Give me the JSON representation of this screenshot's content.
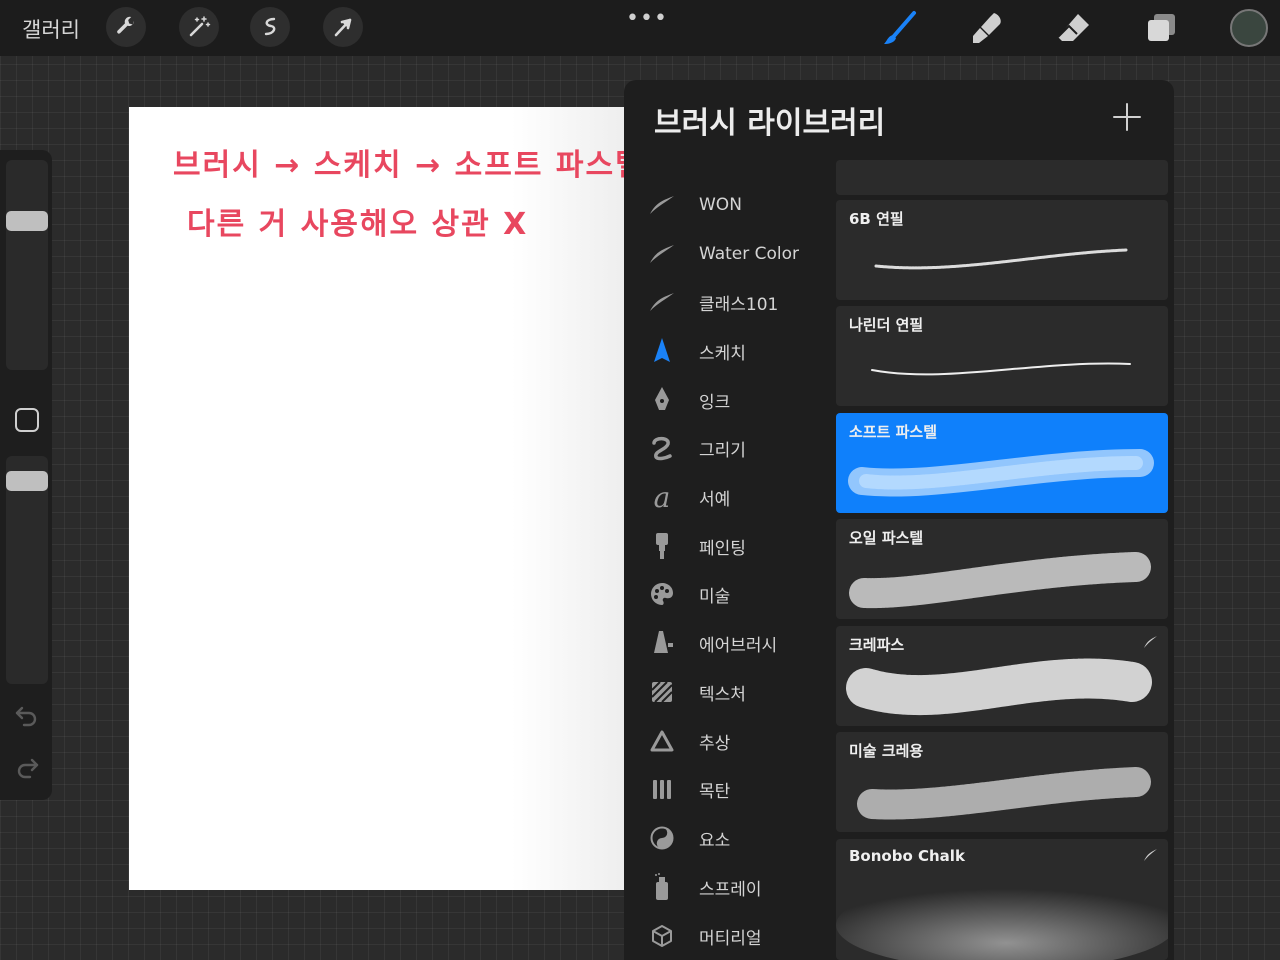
{
  "topbar": {
    "gallery_label": "갤러리",
    "left_tools": [
      "wrench-icon",
      "magic-wand-icon",
      "selection-icon",
      "transform-arrow-icon"
    ],
    "more_label": "•••",
    "right_tools": [
      "brush-icon",
      "smudge-icon",
      "eraser-icon",
      "layers-icon"
    ],
    "active_tool": "brush-icon",
    "accent_color": "#1a82f7",
    "current_color": "#3a463f"
  },
  "sidebar": {
    "brush_size_level": 0.73,
    "opacity_level": 0.93
  },
  "canvas": {
    "note_line1": "브러시 → 스케치 → 소프트 파스텔",
    "note_line2": "다른 거 사용해오 상관 X",
    "ink_color": "#e8475f"
  },
  "panel": {
    "title": "브러시 라이브러리",
    "add_label": "+",
    "sets": [
      {
        "label": "WON",
        "icon": "stroke-icon"
      },
      {
        "label": "Water Color",
        "icon": "stroke-icon"
      },
      {
        "label": "클래스101",
        "icon": "stroke-icon"
      },
      {
        "label": "스케치",
        "icon": "pencil-tip-icon",
        "active": true
      },
      {
        "label": "잉크",
        "icon": "pen-nib-icon"
      },
      {
        "label": "그리기",
        "icon": "squiggle-icon"
      },
      {
        "label": "서예",
        "icon": "calligraphy-a-icon"
      },
      {
        "label": "페인팅",
        "icon": "paint-brush-icon"
      },
      {
        "label": "미술",
        "icon": "palette-icon"
      },
      {
        "label": "에어브러시",
        "icon": "airbrush-icon"
      },
      {
        "label": "텍스처",
        "icon": "texture-icon"
      },
      {
        "label": "추상",
        "icon": "triangle-icon"
      },
      {
        "label": "목탄",
        "icon": "charcoal-icon"
      },
      {
        "label": "요소",
        "icon": "yin-yang-icon"
      },
      {
        "label": "스프레이",
        "icon": "spray-can-icon"
      },
      {
        "label": "머티리얼",
        "icon": "cube-icon"
      }
    ],
    "brushes": [
      {
        "name": "6B 연필"
      },
      {
        "name": "나린더 연필"
      },
      {
        "name": "소프트 파스텔",
        "selected": true
      },
      {
        "name": "오일 파스텔"
      },
      {
        "name": "크레파스",
        "imported": true
      },
      {
        "name": "미술 크레용"
      },
      {
        "name": "Bonobo Chalk",
        "imported": true
      }
    ]
  }
}
